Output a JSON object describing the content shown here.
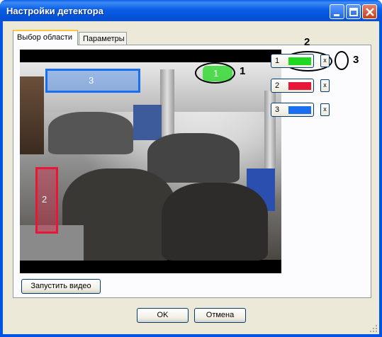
{
  "window": {
    "title": "Настройки детектора",
    "controls": [
      "minimize-icon",
      "maximize-icon",
      "close-icon"
    ]
  },
  "tabs": [
    {
      "label": "Выбор области",
      "active": true
    },
    {
      "label": "Параметры",
      "active": false
    }
  ],
  "zones": [
    {
      "id": "1",
      "color": "#1fd81f"
    },
    {
      "id": "2",
      "color": "#e8173a"
    },
    {
      "id": "3",
      "color": "#1a6ff0"
    }
  ],
  "zone_delete_label": "x",
  "callouts": [
    "1",
    "2",
    "3"
  ],
  "buttons": {
    "start_video": "Запустить видео",
    "ok": "OK",
    "cancel": "Отмена"
  }
}
